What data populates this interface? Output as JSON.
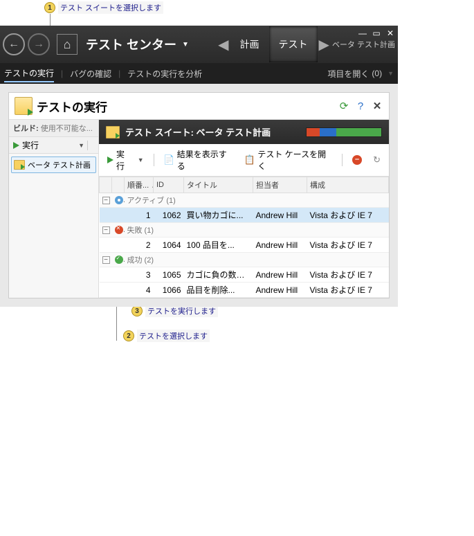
{
  "annotations": {
    "a1": "テスト スイートを選択します",
    "a2": "テストを選択します",
    "a3": "テストを実行します"
  },
  "header": {
    "center_title": "テスト センター",
    "tabs": {
      "plan": "計画",
      "test": "テスト"
    },
    "breadcrumb": "ベータ テスト計画"
  },
  "subnav": {
    "items": [
      "テストの実行",
      "バグの確認",
      "テストの実行を分析"
    ],
    "right": {
      "label": "項目を開く",
      "count": "(0)"
    }
  },
  "panel": {
    "title": "テストの実行",
    "build_label": "ビルド:",
    "build_value": "使用不可能な...",
    "side_run": "実行",
    "tree_item": "ベータ テスト計画",
    "suite_title": "テスト スイート: ベータ テスト計画",
    "toolbar": {
      "run": "実行",
      "show_results": "結果を表示する",
      "open_case": "テスト ケースを開く"
    },
    "columns": {
      "order": "順番...",
      "id": "ID",
      "title": "タイトル",
      "assignee": "担当者",
      "config": "構成"
    },
    "groups": {
      "active": "アクティブ  (1)",
      "failed": "失敗 (1)",
      "passed": "成功 (2)"
    },
    "rows": [
      {
        "n": "1",
        "id": "1062",
        "title": "買い物カゴに...",
        "assignee": "Andrew Hill",
        "config": "Vista および IE 7"
      },
      {
        "n": "2",
        "id": "1064",
        "title": "100 品目を...",
        "assignee": "Andrew Hill",
        "config": "Vista および IE 7"
      },
      {
        "n": "3",
        "id": "1065",
        "title": "カゴに負の数を...",
        "assignee": "Andrew Hill",
        "config": "Vista および IE 7"
      },
      {
        "n": "4",
        "id": "1066",
        "title": "品目を削除...",
        "assignee": "Andrew Hill",
        "config": "Vista および IE 7"
      }
    ]
  }
}
